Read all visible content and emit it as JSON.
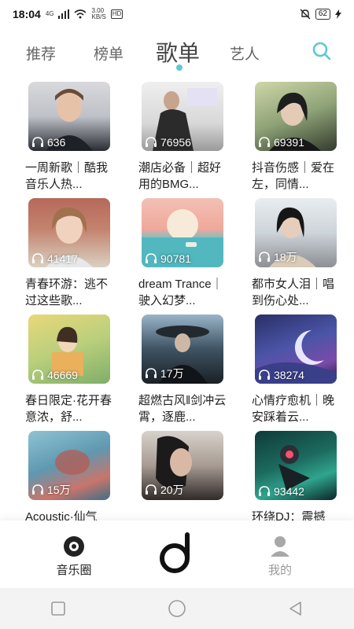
{
  "status_bar": {
    "time": "18:04",
    "signal": "4G",
    "speed_value": "3.00",
    "speed_unit": "KB/S",
    "hd": "HD",
    "battery": "62"
  },
  "tabs": [
    {
      "label": "推荐",
      "active": false
    },
    {
      "label": "榜单",
      "active": false
    },
    {
      "label": "歌单",
      "active": true
    },
    {
      "label": "艺人",
      "active": false
    }
  ],
  "playlists": [
    {
      "plays": "636",
      "title": "一周新歌｜酷我音乐人热..."
    },
    {
      "plays": "76956",
      "title": "潮店必备｜超好用的BMG..."
    },
    {
      "plays": "69391",
      "title": "抖音伤感｜爱在左，同情..."
    },
    {
      "plays": "41417",
      "title": "青春环游：逃不过这些歌..."
    },
    {
      "plays": "90781",
      "title": "dream Trance｜驶入幻梦..."
    },
    {
      "plays": "18万",
      "title": "都市女人泪｜唱到伤心处..."
    },
    {
      "plays": "46669",
      "title": "春日限定·花开春意浓，舒..."
    },
    {
      "plays": "17万",
      "title": "超燃古风‖剑冲云霄，逐鹿..."
    },
    {
      "plays": "38274",
      "title": "心情疗愈机｜晚安踩着云..."
    },
    {
      "plays": "15万",
      "title": "Acoustic·仙气"
    },
    {
      "plays": "20万",
      "title": ""
    },
    {
      "plays": "93442",
      "title": "环绕DJ：震撼"
    }
  ],
  "bottom_nav": {
    "home_label": "音乐圈",
    "me_label": "我的"
  },
  "colors": {
    "accent": "#5ec8d4",
    "nav_inactive": "#9a9a9a"
  }
}
